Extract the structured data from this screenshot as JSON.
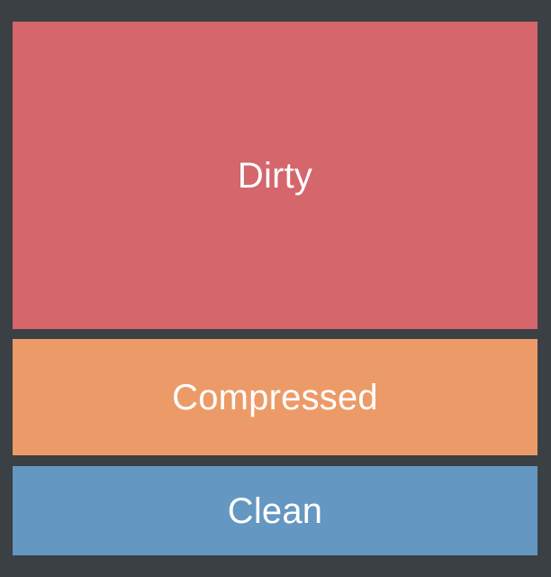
{
  "blocks": [
    {
      "label": "Dirty",
      "color": "#d4666c"
    },
    {
      "label": "Compressed",
      "color": "#ec9b68"
    },
    {
      "label": "Clean",
      "color": "#6497c1"
    }
  ],
  "background_color": "#3b4045"
}
